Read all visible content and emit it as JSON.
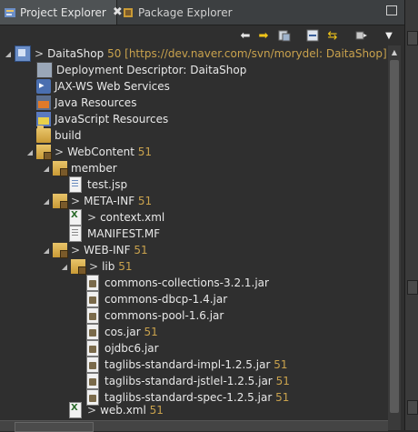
{
  "tabs": [
    {
      "label": "Project Explorer",
      "active": true,
      "close": "✖"
    },
    {
      "label": "Package Explorer",
      "active": false
    }
  ],
  "toolbar": {
    "back_icon": "back-arrow-icon",
    "forward_icon": "forward-arrow-icon",
    "link_icon": "link-with-editor-icon",
    "collapse_icon": "collapse-all-icon",
    "sync_icon": "sync-icon",
    "view_icon": "view-menu-icon",
    "menu_icon": "chevron-down-icon"
  },
  "tree": {
    "project": {
      "prefix": ">",
      "name": "DaitaShop",
      "decoration": "50 [https://dev.naver.com/svn/morydel: DaitaShop]"
    },
    "deployment_descriptor": "Deployment Descriptor: DaitaShop",
    "jaxws": "JAX-WS Web Services",
    "java_resources": "Java Resources",
    "js_resources": "JavaScript Resources",
    "build": "build",
    "webcontent": {
      "prefix": ">",
      "name": "WebContent",
      "decoration": "51"
    },
    "member": "member",
    "test_jsp": "test.jsp",
    "meta_inf": {
      "prefix": ">",
      "name": "META-INF",
      "decoration": "51"
    },
    "context_xml": {
      "prefix": ">",
      "name": "context.xml"
    },
    "manifest": "MANIFEST.MF",
    "web_inf": {
      "prefix": ">",
      "name": "WEB-INF",
      "decoration": "51"
    },
    "lib": {
      "prefix": ">",
      "name": "lib",
      "decoration": "51"
    },
    "jars": [
      {
        "name": "commons-collections-3.2.1.jar",
        "decoration": ""
      },
      {
        "name": "commons-dbcp-1.4.jar",
        "decoration": ""
      },
      {
        "name": "commons-pool-1.6.jar",
        "decoration": ""
      },
      {
        "name": "cos.jar",
        "decoration": "51"
      },
      {
        "name": "ojdbc6.jar",
        "decoration": ""
      },
      {
        "name": "taglibs-standard-impl-1.2.5.jar",
        "decoration": "51"
      },
      {
        "name": "taglibs-standard-jstlel-1.2.5.jar",
        "decoration": "51"
      },
      {
        "name": "taglibs-standard-spec-1.2.5.jar",
        "decoration": "51"
      }
    ],
    "web_xml": {
      "prefix": ">",
      "name": "web.xml",
      "decoration": "51"
    }
  },
  "colors": {
    "background": "#2f2f2f",
    "text": "#e8e8e8",
    "decoration": "#c9a24d",
    "folder": "#e8c46a"
  }
}
